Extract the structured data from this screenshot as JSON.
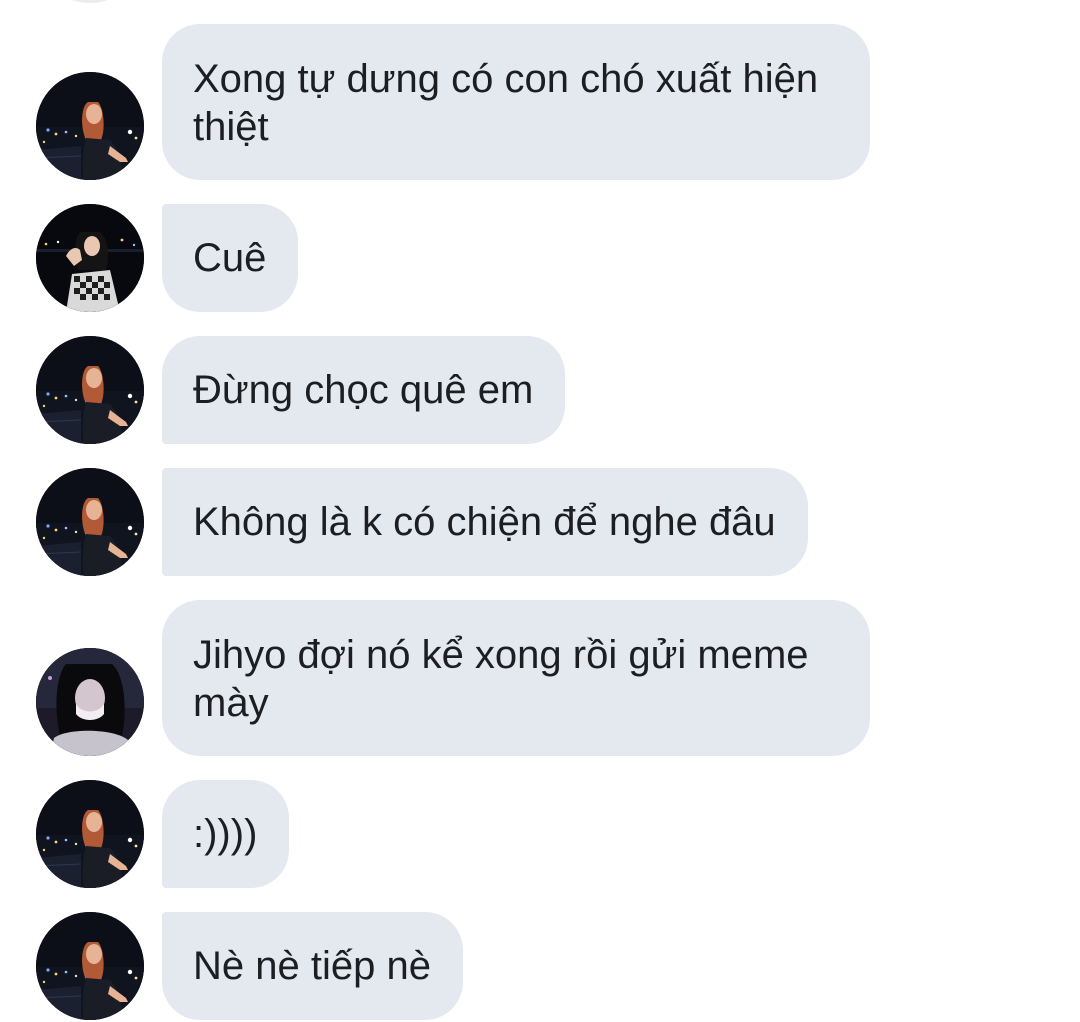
{
  "messages": [
    {
      "sender": "girl-red-hair",
      "text": "Xong tự dưng có con chó xuất hiện thiệt"
    },
    {
      "sender": "girl-checkered",
      "text": "Cuê"
    },
    {
      "sender": "girl-red-hair",
      "text": "Đừng chọc quê em"
    },
    {
      "sender": "girl-red-hair",
      "text": "Không là k có chiện để nghe đâu"
    },
    {
      "sender": "girl-mask",
      "text": "Jihyo đợi nó kể xong rồi gửi meme mày"
    },
    {
      "sender": "girl-red-hair",
      "text": ":))))"
    },
    {
      "sender": "girl-red-hair",
      "text": "Nè nè tiếp nè"
    }
  ],
  "colors": {
    "bubble": "#e4e9ef",
    "text": "#1c1e21",
    "background": "#ffffff"
  }
}
